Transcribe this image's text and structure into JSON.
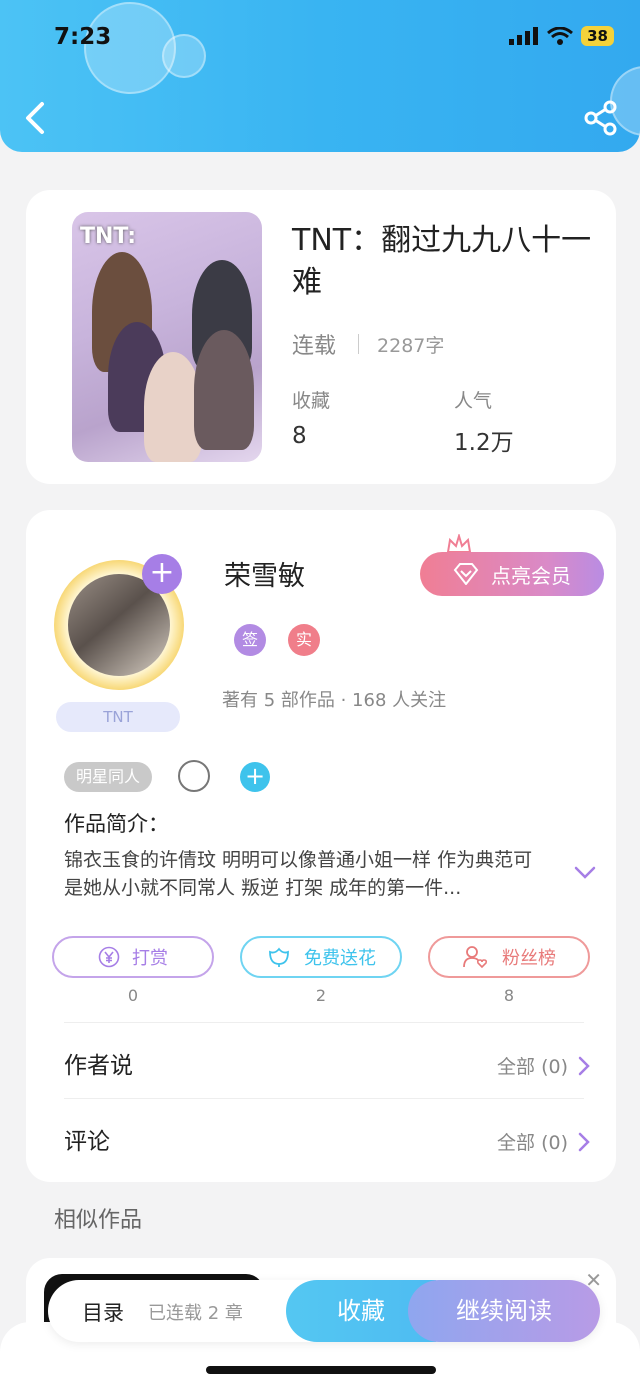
{
  "status": {
    "time": "7:23",
    "battery": "38"
  },
  "book": {
    "title": "TNT：翻过九九八十一难",
    "cover_text": "TNT:",
    "status": "连载",
    "word_count": "2287字",
    "collect_label": "收藏",
    "collect_value": "8",
    "popularity_label": "人气",
    "popularity_value": "1.2万"
  },
  "author": {
    "name": "荣雪敏",
    "badge": "TNT",
    "vip_button": "点亮会员",
    "tag_sign": "签",
    "tag_real": "实",
    "works_line": "著有 5 部作品 · 168 人关注",
    "genre_tag": "明星同人",
    "intro_label": "作品简介：",
    "intro_text": "锦衣玉食的许倩玟 明明可以像普通小姐一样 作为典范可是她从小就不同常人  叛逆 打架 成年的第一件..."
  },
  "actions": [
    {
      "label": "打赏",
      "count": "0"
    },
    {
      "label": "免费送花",
      "count": "2"
    },
    {
      "label": "粉丝榜",
      "count": "8"
    }
  ],
  "rows": {
    "author_says": {
      "title": "作者说",
      "right": "全部 (0)"
    },
    "comments": {
      "title": "评论",
      "right": "全部 (0)"
    }
  },
  "similar": {
    "title": "相似作品"
  },
  "reader_bar": {
    "toc": "目录",
    "chapters": "已连载 2 章",
    "collect": "收藏",
    "continue": "继续阅读"
  },
  "colors": {
    "header_blue": "#39b4f2",
    "purple": "#a67ee6",
    "cyan": "#3ec3ec",
    "pink": "#f07e94"
  }
}
